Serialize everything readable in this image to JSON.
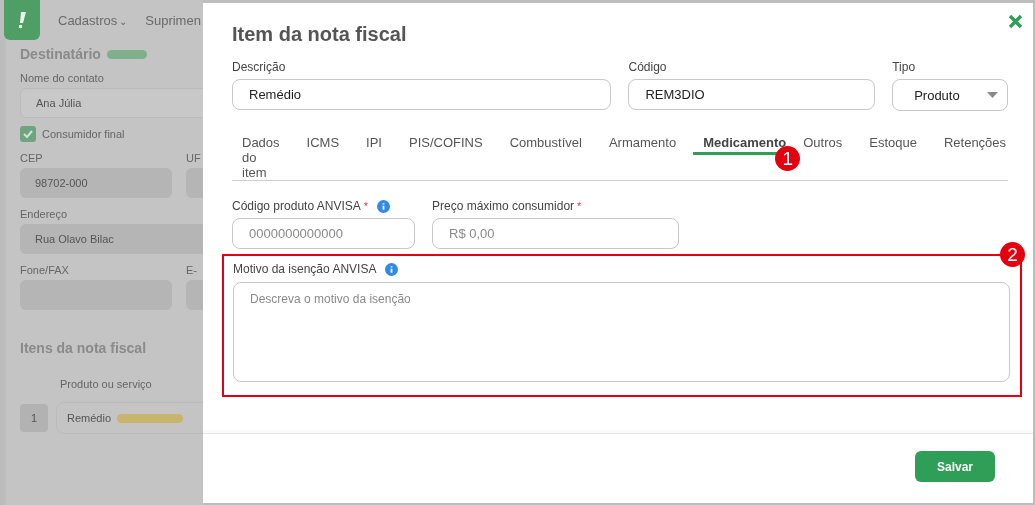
{
  "background_page": {
    "nav": [
      {
        "label": "Cadastros",
        "caret": "⌄"
      },
      {
        "label": "Suprimen"
      }
    ],
    "recipient": {
      "title": "Destinatário",
      "contact_label": "Nome do contato",
      "contact_value": "Ana Júlia",
      "final_consumer": {
        "label": "Consumidor final",
        "checked": true
      },
      "cep_label": "CEP",
      "cep_value": "98702-000",
      "uf_label": "UF",
      "address_label": "Endereço",
      "address_value": "Rua Olavo Bilac",
      "phone_label": "Fone/FAX",
      "email_label": "E-"
    },
    "items_section": {
      "title": "Itens da nota fiscal",
      "column": "Produto ou serviço",
      "rows": [
        {
          "number": "1",
          "product": "Remédio"
        }
      ]
    }
  },
  "dialog": {
    "title": "Item da nota fiscal",
    "description": {
      "label": "Descrição",
      "value": "Remédio"
    },
    "code": {
      "label": "Código",
      "value": "REM3DIO"
    },
    "type": {
      "label": "Tipo",
      "value": "Produto"
    },
    "tabs": [
      {
        "label": "Dados do item",
        "selected": false
      },
      {
        "label": "ICMS",
        "selected": false
      },
      {
        "label": "IPI",
        "selected": false
      },
      {
        "label": "PIS/COFINS",
        "selected": false
      },
      {
        "label": "Combustível",
        "selected": false
      },
      {
        "label": "Armamento",
        "selected": false
      },
      {
        "label": "Medicamento",
        "selected": true,
        "annotation": "1"
      },
      {
        "label": "Outros",
        "selected": false
      },
      {
        "label": "Estoque",
        "selected": false
      },
      {
        "label": "Retenções",
        "selected": false
      }
    ],
    "anvisa_code": {
      "label": "Código produto ANVISA",
      "required_mark": "*",
      "info": true,
      "placeholder": "0000000000000"
    },
    "max_price": {
      "label": "Preço máximo consumidor",
      "required_mark": "*",
      "placeholder": "R$ 0,00"
    },
    "exemption": {
      "label": "Motivo da isenção ANVISA",
      "info": true,
      "placeholder": "Descreva o motivo da isenção",
      "highlighted": true,
      "annotation": "2"
    },
    "save_button": "Salvar"
  }
}
